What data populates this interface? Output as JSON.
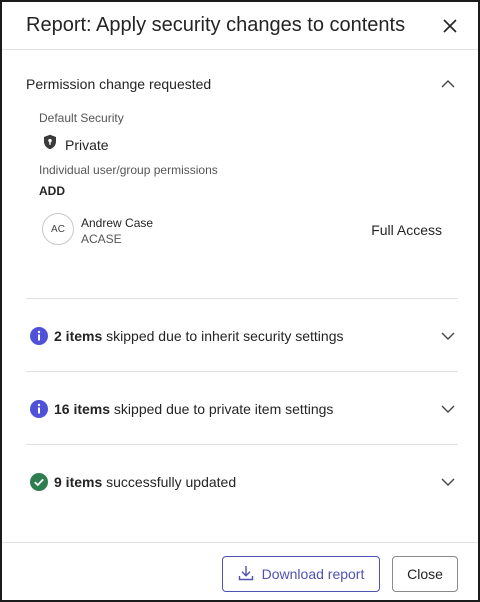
{
  "dialog": {
    "title": "Report: Apply security changes to contents"
  },
  "permission": {
    "heading": "Permission change requested",
    "default_security_label": "Default Security",
    "default_security_value": "Private",
    "individual_label": "Individual user/group permissions",
    "action_label": "ADD",
    "user": {
      "initials": "AC",
      "name": "Andrew Case",
      "id": "ACASE",
      "access": "Full Access"
    }
  },
  "summaries": [
    {
      "count": "2 items",
      "text": " skipped due to inherit security settings",
      "icon": "info-icon",
      "color": "#4f52d6"
    },
    {
      "count": "16 items",
      "text": " skipped due to private item settings",
      "icon": "info-icon",
      "color": "#4f52d6"
    },
    {
      "count": "9 items",
      "text": " successfully updated",
      "icon": "check-circle-icon",
      "color": "#2e7d4f"
    }
  ],
  "footer": {
    "download_label": "Download report",
    "close_label": "Close"
  }
}
